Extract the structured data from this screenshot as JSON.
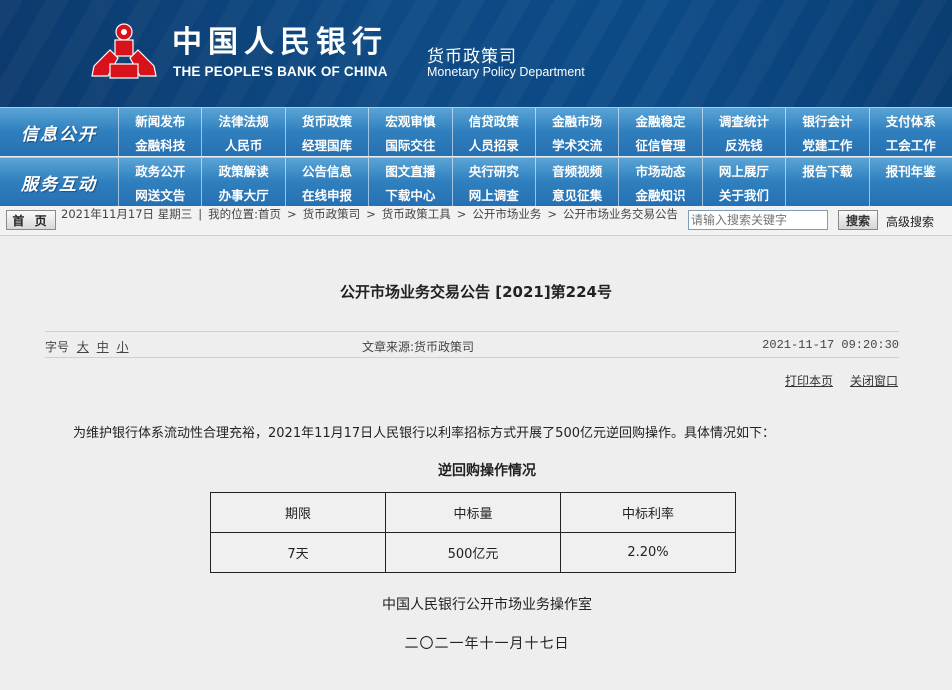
{
  "header": {
    "cn_name": "中国人民银行",
    "en_name": "THE PEOPLE'S BANK OF CHINA",
    "dept_cn": "货币政策司",
    "dept_en": "Monetary Policy Department",
    "logo_icon": "pboc-logo-icon",
    "logo_color": "#d7121b"
  },
  "nav": [
    {
      "title": "信息公开",
      "items": [
        "新闻发布",
        "法律法规",
        "货币政策",
        "宏观审慎",
        "信贷政策",
        "金融市场",
        "金融稳定",
        "调查统计",
        "银行会计",
        "支付体系",
        "金融科技",
        "人民币",
        "经理国库",
        "国际交往",
        "人员招录",
        "学术交流",
        "征信管理",
        "反洗钱",
        "党建工作",
        "工会工作"
      ]
    },
    {
      "title": "服务互动",
      "items": [
        "政务公开",
        "政策解读",
        "公告信息",
        "图文直播",
        "央行研究",
        "音频视频",
        "市场动态",
        "网上展厅",
        "报告下载",
        "报刊年鉴",
        "网送文告",
        "办事大厅",
        "在线申报",
        "下载中心",
        "网上调查",
        "意见征集",
        "金融知识",
        "关于我们",
        "",
        ""
      ]
    }
  ],
  "crumbbar": {
    "home_label": "首 页",
    "date": "2021年11月17日  星期三",
    "location_label": "我的位置:",
    "crumbs": [
      "首页",
      "货币政策司",
      "货币政策工具",
      "公开市场业务",
      "公开市场业务交易公告"
    ],
    "search_placeholder": "请输入搜索关键字",
    "search_label": "搜索",
    "advanced_label": "高级搜索"
  },
  "article": {
    "title": "公开市场业务交易公告 [2021]第224号",
    "fontsize_label": "字号",
    "fontsize_options": [
      "大",
      "中",
      "小"
    ],
    "source": "文章来源:货币政策司",
    "pub_time": "2021-11-17 09:20:30",
    "print_label": "打印本页",
    "close_label": "关闭窗口",
    "intro": "为维护银行体系流动性合理充裕，2021年11月17日人民银行以利率招标方式开展了500亿元逆回购操作。具体情况如下：",
    "table_title": "逆回购操作情况",
    "table": {
      "headers": [
        "期限",
        "中标量",
        "中标利率"
      ],
      "rows": [
        [
          "7天",
          "500亿元",
          "2.20%"
        ]
      ]
    },
    "signature": "中国人民银行公开市场业务操作室",
    "date_cn": "二〇二一年十一月十七日"
  }
}
